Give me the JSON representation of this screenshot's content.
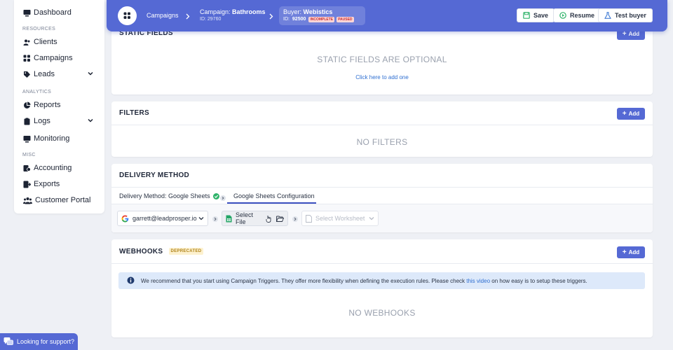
{
  "sidebar": {
    "top_item": "Dashboard",
    "section_resources": "RESOURCES",
    "section_analytics": "ANALYTICS",
    "section_misc": "MISC",
    "items": {
      "clients": "Clients",
      "campaigns": "Campaigns",
      "leads": "Leads",
      "reports": "Reports",
      "logs": "Logs",
      "monitoring": "Monitoring",
      "accounting": "Accounting",
      "exports": "Exports",
      "customer_portal": "Customer Portal"
    }
  },
  "header": {
    "crumb_campaigns": "Campaigns",
    "campaign_prefix": "Campaign:",
    "campaign_name": "Bathrooms",
    "campaign_id": "ID: 29760",
    "buyer_prefix": "Buyer:",
    "buyer_name": "Webistics",
    "buyer_id_label": "ID:",
    "buyer_id": "92500",
    "badge_incomplete": "INCOMPLETE",
    "badge_paused": "PAUSED",
    "save_label": "Save",
    "resume_label": "Resume",
    "test_buyer_label": "Test buyer"
  },
  "static_fields": {
    "title": "STATIC FIELDS",
    "add_label": "Add",
    "empty": "STATIC FIELDS ARE OPTIONAL",
    "link": "Click here to add one"
  },
  "filters": {
    "title": "FILTERS",
    "add_label": "Add",
    "empty": "NO FILTERS"
  },
  "delivery": {
    "title": "DELIVERY METHOD",
    "tab1": "Delivery Method: Google Sheets",
    "tab2": "Google Sheets Configuration",
    "account": "garrett@leadprosper.io",
    "select_file": "Select File",
    "select_worksheet": "Select Worksheet"
  },
  "webhooks": {
    "title": "WEBHOOKS",
    "badge": "DEPRECATED",
    "add_label": "Add",
    "info_text_1": "We recommend that you start using Campaign Triggers. They offer more flexibility when defining the execution rules. Please check ",
    "info_link": "this video",
    "info_text_2": " on how easy is to setup these triggers.",
    "empty": "NO WEBHOOKS"
  },
  "support": {
    "label": "Looking for support?"
  },
  "colors": {
    "accent": "#5569d4",
    "success": "#2fb36a",
    "link": "#2f6fd1"
  }
}
